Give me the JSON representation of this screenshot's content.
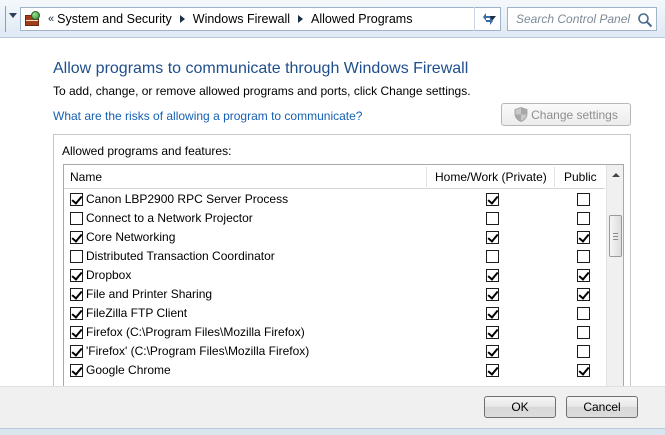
{
  "address_bar": {
    "overflow_chevron": "«",
    "breadcrumbs": [
      "System and Security",
      "Windows Firewall",
      "Allowed Programs"
    ],
    "refresh_icon": "refresh-arrows-icon",
    "search_placeholder": "Search Control Panel"
  },
  "header": {
    "title": "Allow programs to communicate through Windows Firewall",
    "description": "To add, change, or remove allowed programs and ports, click Change settings.",
    "risk_link": "What are the risks of allowing a program to communicate?",
    "change_settings_label": "Change settings"
  },
  "programs": {
    "group_label": "Allowed programs and features:",
    "columns": [
      "Name",
      "Home/Work (Private)",
      "Public"
    ],
    "rows": [
      {
        "name": "Canon LBP2900 RPC Server Process",
        "enabled": true,
        "private": true,
        "public": false
      },
      {
        "name": "Connect to a Network Projector",
        "enabled": false,
        "private": false,
        "public": false
      },
      {
        "name": "Core Networking",
        "enabled": true,
        "private": true,
        "public": true
      },
      {
        "name": "Distributed Transaction Coordinator",
        "enabled": false,
        "private": false,
        "public": false
      },
      {
        "name": "Dropbox",
        "enabled": true,
        "private": true,
        "public": true
      },
      {
        "name": "File and Printer Sharing",
        "enabled": true,
        "private": true,
        "public": true
      },
      {
        "name": "FileZilla FTP Client",
        "enabled": true,
        "private": true,
        "public": false
      },
      {
        "name": "Firefox (C:\\Program Files\\Mozilla Firefox)",
        "enabled": true,
        "private": true,
        "public": false
      },
      {
        "name": "'Firefox' (C:\\Program Files\\Mozilla Firefox)",
        "enabled": true,
        "private": true,
        "public": false
      },
      {
        "name": "Google Chrome",
        "enabled": true,
        "private": true,
        "public": true
      }
    ]
  },
  "footer": {
    "ok_label": "OK",
    "cancel_label": "Cancel"
  },
  "colors": {
    "title": "#1e4e8c",
    "link": "#1660b3",
    "disabled_text": "#8e8e8e"
  }
}
